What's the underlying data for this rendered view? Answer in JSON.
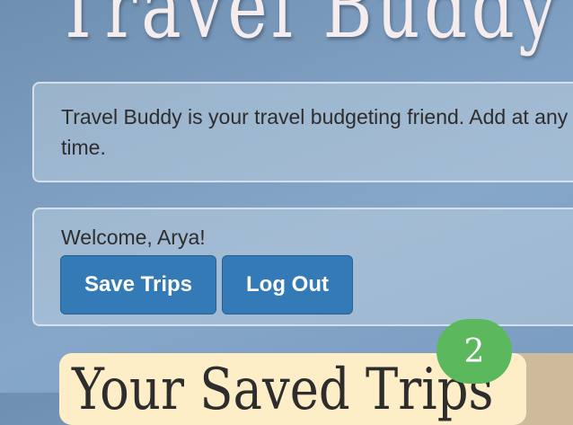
{
  "app": {
    "title": "Travel Buddy"
  },
  "intro": {
    "text": "Travel Buddy is your travel budgeting friend. Add at any time."
  },
  "user_panel": {
    "welcome": "Welcome, Arya!",
    "save_label": "Save Trips",
    "logout_label": "Log Out"
  },
  "saved_trips": {
    "title": "Your Saved Trips",
    "count": "2"
  },
  "colors": {
    "primary_button": "#337ab7",
    "badge": "#5cb85c",
    "card": "#fdeec8"
  }
}
